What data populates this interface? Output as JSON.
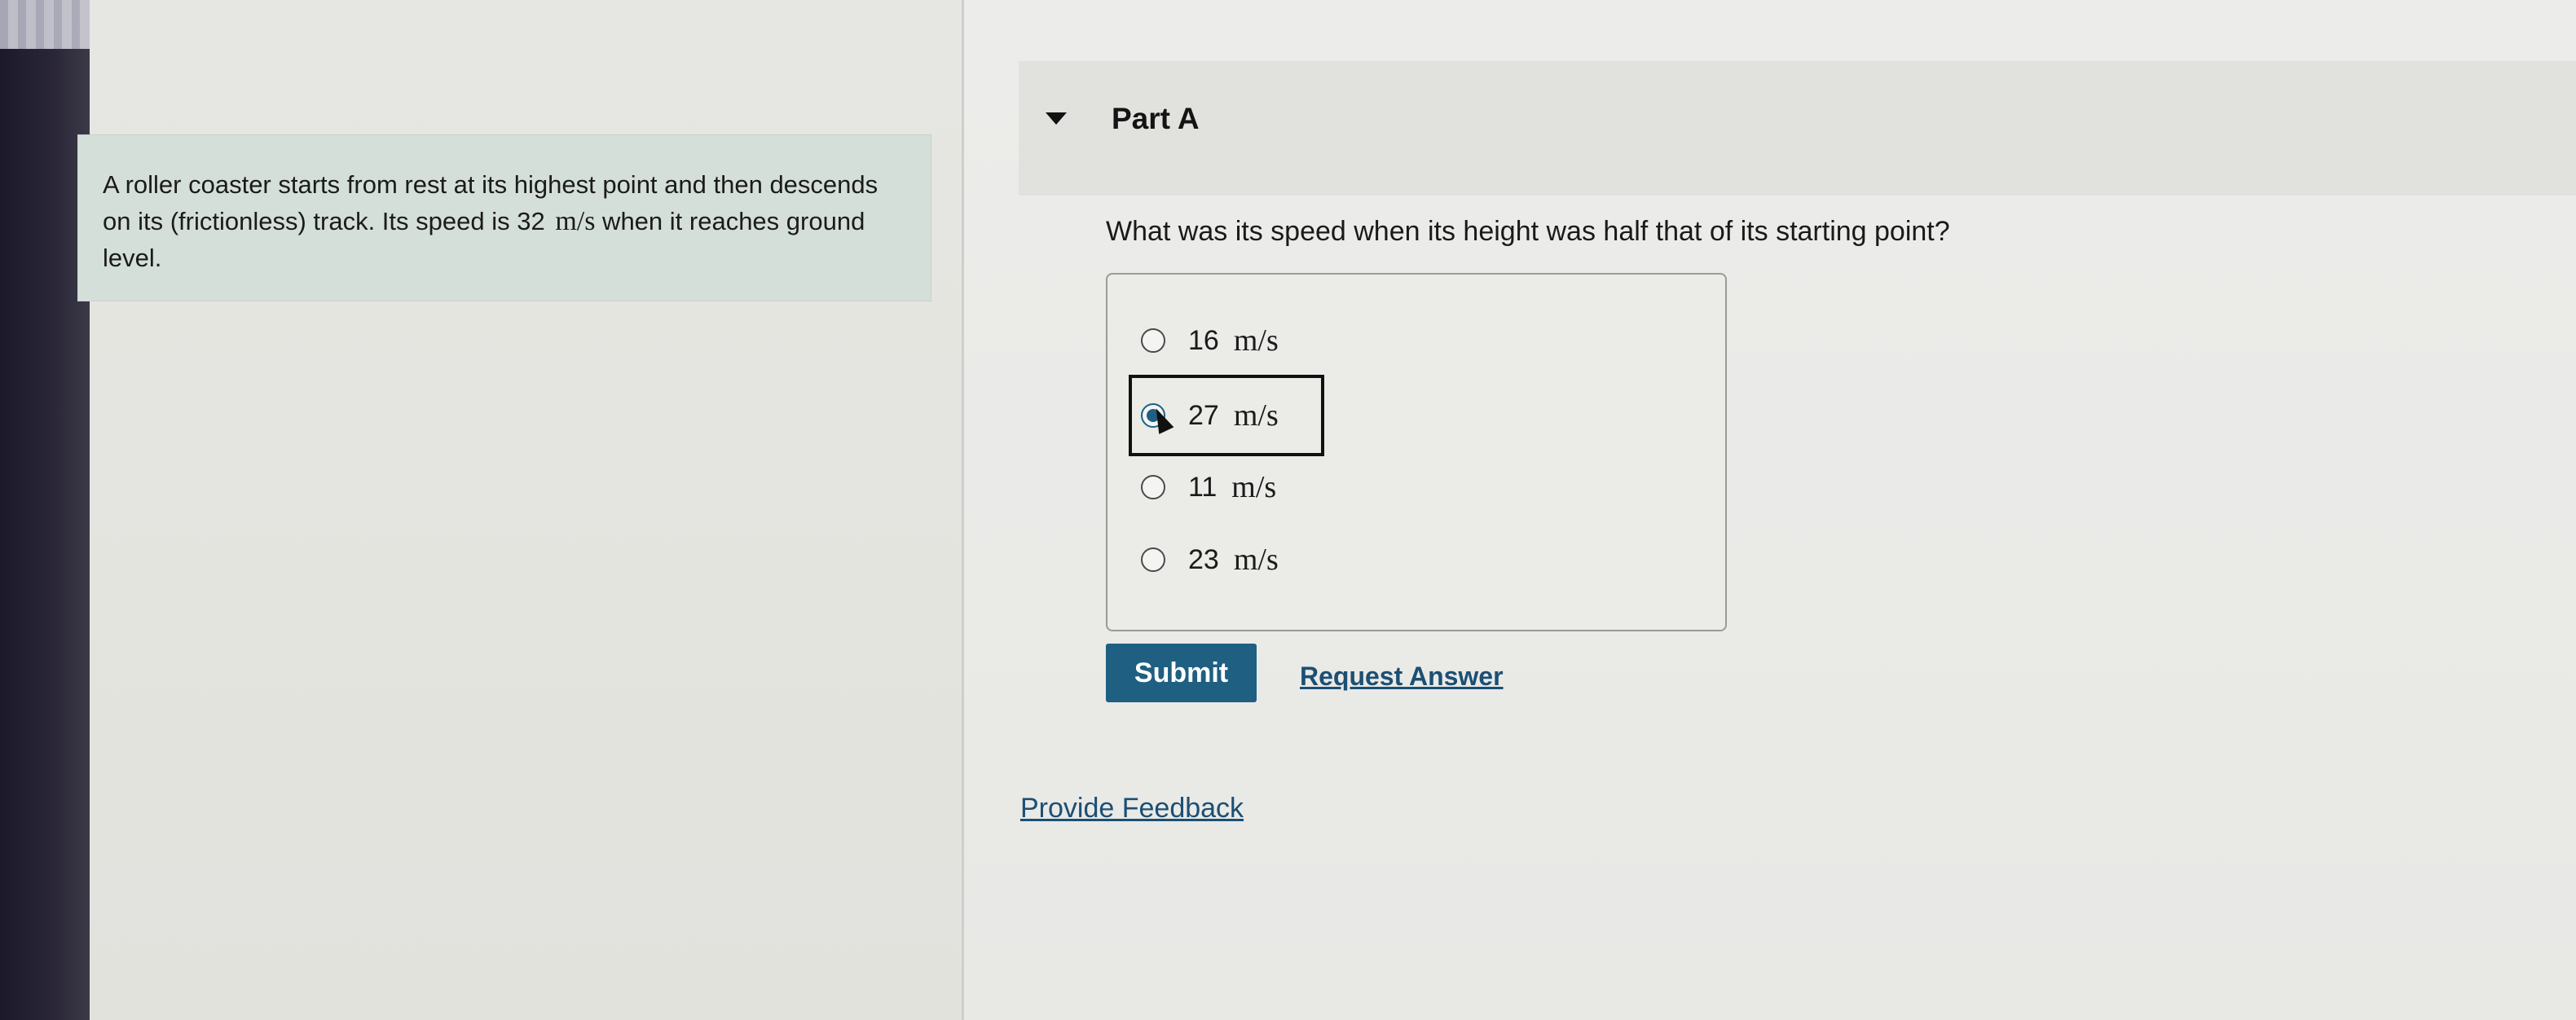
{
  "problem": {
    "text_before": "A roller coaster starts from rest at its highest point and then descends on its (frictionless) track. Its speed is 32 ",
    "unit": "m/s",
    "text_after": " when it reaches ground level."
  },
  "part": {
    "title": "Part A",
    "question": "What was its speed when its height was half that of its starting point?"
  },
  "options": [
    {
      "value": "16",
      "unit": "m/s",
      "selected": false
    },
    {
      "value": "27",
      "unit": "m/s",
      "selected": true
    },
    {
      "value": "11",
      "unit": "m/s",
      "selected": false
    },
    {
      "value": "23",
      "unit": "m/s",
      "selected": false
    }
  ],
  "actions": {
    "submit_label": "Submit",
    "request_answer_label": "Request Answer",
    "feedback_label": "Provide Feedback"
  },
  "colors": {
    "accent": "#1e5f82",
    "link": "#1c4f73",
    "problem_bg": "#d5dfd9"
  }
}
